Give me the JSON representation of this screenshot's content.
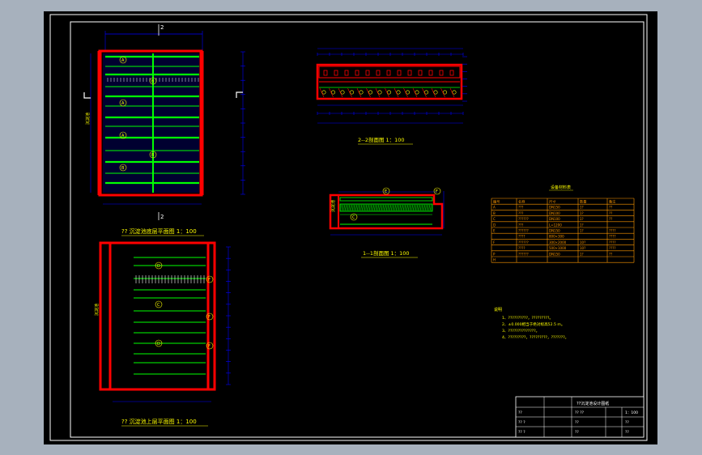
{
  "colors": {
    "background": "#a7b1bd",
    "sheet": "#000000",
    "border": "#ffffff",
    "wall": "#ff0000",
    "pipe": "#00ff00",
    "dimension": "#0000ff",
    "text": "#ffff00",
    "table": "#ff9900"
  },
  "labels": {
    "lower_plan_title": "?? 沉淀池底层平面图 1：100",
    "upper_plan_title": "?? 沉淀池上层平面图 1：100",
    "section_22_title": "2--2剖面图 1：100",
    "section_11_title": "1--1剖面图 1：100",
    "table_title": "设备材料表",
    "notes_heading": "说明",
    "section_mark": "2",
    "side_label": "沉淀池"
  },
  "lower_plan_markers": [
    "A",
    "B",
    "A",
    "A",
    "B",
    "B"
  ],
  "upper_plan_markers": [
    "D",
    "F",
    "C",
    "F",
    "D",
    "F"
  ],
  "section11_markers": [
    "E",
    "F",
    "C"
  ],
  "material_table": {
    "headers": [
      "编号",
      "名称",
      "尺寸",
      "数量",
      "备注"
    ],
    "rows": [
      [
        "A",
        "???",
        "DN150",
        "1?",
        "??"
      ],
      [
        "B",
        "???",
        "DN100",
        "1?",
        "??"
      ],
      [
        "C",
        "??????",
        "DN100",
        "1?",
        "??"
      ],
      [
        "D",
        "???",
        "L=1200",
        "1?",
        ""
      ],
      [
        "E",
        "??????",
        "DN150",
        "1?",
        "????"
      ],
      [
        "",
        "????",
        "800×300",
        "",
        "????"
      ],
      [
        "F",
        "??????",
        "300×2000",
        "10?",
        "????"
      ],
      [
        "",
        "????",
        "500×1000",
        "10?",
        "????"
      ],
      [
        "P",
        "??????",
        "DN150",
        "1?",
        "??"
      ],
      [
        "H",
        "",
        "",
        "",
        ""
      ]
    ]
  },
  "notes": [
    "1、??????????，?????????。",
    "2、±0.000相当于绝对标高52.5 m。",
    "3、??????????????。",
    "4、?????????，?????????，???????。"
  ],
  "title_block": {
    "project": "??沉淀池设计图纸",
    "rows": [
      [
        "??",
        "",
        "?? ??",
        "1：100"
      ],
      [
        "?? ?",
        "",
        "??",
        "??"
      ],
      [
        "?? ?",
        "",
        "??",
        "??"
      ]
    ]
  }
}
